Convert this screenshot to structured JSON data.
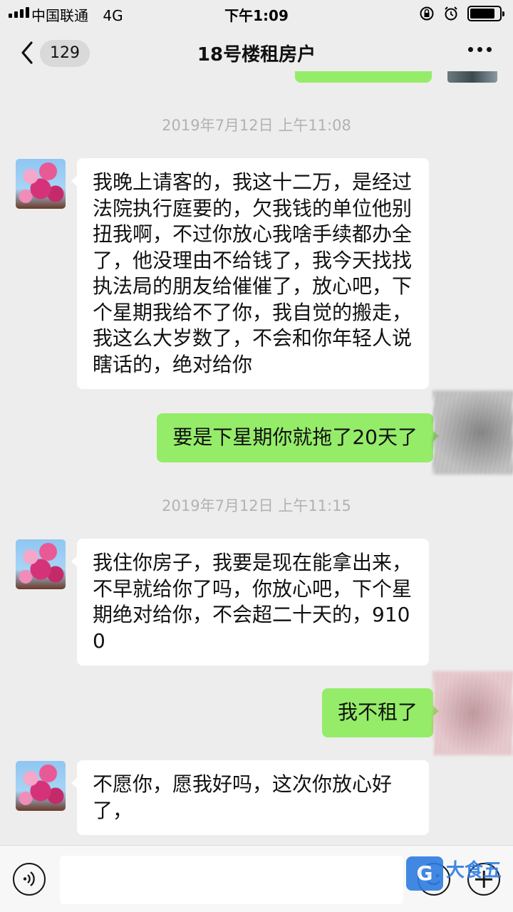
{
  "status_bar": {
    "carrier": "中国联通",
    "network": "4G",
    "time": "下午1:09",
    "battery_level": 0.85
  },
  "nav": {
    "unread_count": "129",
    "title": "18号楼租房户"
  },
  "timestamps": [
    "2019年7月12日 上午11:08",
    "2019年7月12日 上午11:15"
  ],
  "messages": [
    {
      "side": "left",
      "text": "我晚上请客的，我这十二万，是经过法院执行庭要的，欠我钱的单位他别扭我啊，不过你放心我啥手续都办全了，他没理由不给钱了，我今天找找执法局的朋友给催催了，放心吧，下个星期我给不了你，我自觉的搬走，我这么大岁数了，不会和你年轻人说瞎话的，绝对给你"
    },
    {
      "side": "right",
      "text": "要是下星期你就拖了20天了"
    },
    {
      "side": "left",
      "text": "我住你房子，我要是现在能拿出来，不早就给你了吗，你放心吧，下个星期绝对给你，不会超二十天的，9100"
    },
    {
      "side": "right",
      "text": "我不租了"
    },
    {
      "side": "left",
      "text": "不愿你，愿我好吗，这次你放心好了，"
    }
  ],
  "input": {
    "value": "",
    "placeholder": ""
  },
  "watermark": {
    "text": "大食五"
  },
  "colors": {
    "chat_background": "#ededed",
    "self_bubble": "#95ec69",
    "other_bubble": "#ffffff",
    "timestamp": "#b2b2b2"
  }
}
